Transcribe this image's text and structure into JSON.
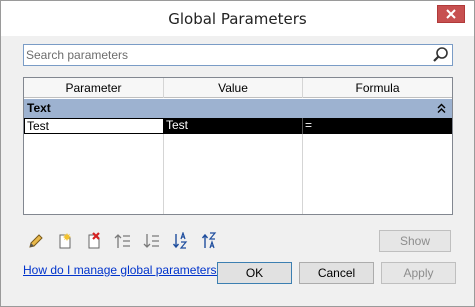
{
  "window": {
    "title": "Global Parameters"
  },
  "search": {
    "placeholder": "Search parameters",
    "value": ""
  },
  "grid": {
    "columns": [
      "Parameter",
      "Value",
      "Formula"
    ],
    "groups": [
      {
        "label": "Text",
        "rows": [
          {
            "parameter": "Test",
            "value": "Test",
            "formula": "="
          }
        ]
      }
    ]
  },
  "toolbar": {
    "icons": [
      "edit-icon",
      "new-parameter-icon",
      "delete-parameter-icon",
      "move-up-icon",
      "move-down-icon",
      "sort-ascending-icon",
      "sort-descending-icon"
    ]
  },
  "buttons": {
    "show": "Show",
    "ok": "OK",
    "cancel": "Cancel",
    "apply": "Apply"
  },
  "help_link": "How do I manage global parameters?",
  "colors": {
    "group_header": "#9db2d0",
    "selection": "#000000",
    "link": "#0033cc",
    "close": "#c75050"
  }
}
